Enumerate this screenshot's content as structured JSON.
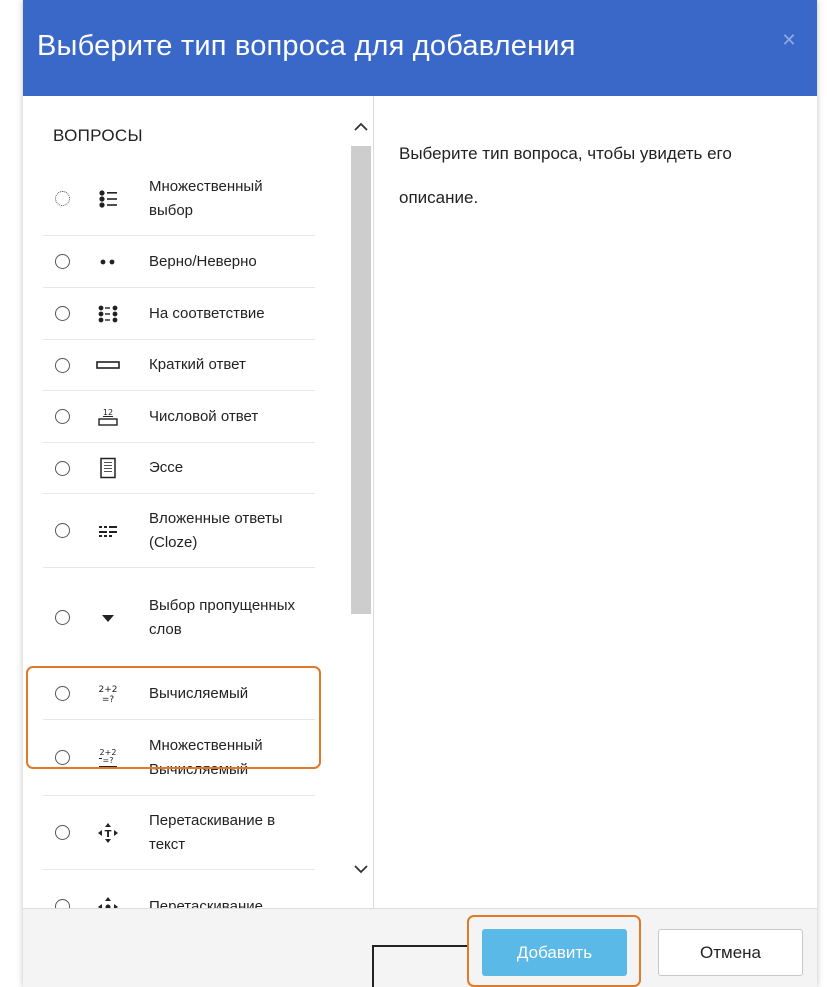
{
  "dialog": {
    "title": "Выберите тип вопроса для добавления",
    "close_icon": "close-icon"
  },
  "left": {
    "heading": "ВОПРОСЫ",
    "items": [
      {
        "label": "Множественный выбор",
        "icon": "multichoice-icon",
        "lines": 2,
        "dotted": true
      },
      {
        "label": "Верно/Неверно",
        "icon": "truefalse-icon",
        "lines": 1
      },
      {
        "label": "На соответствие",
        "icon": "match-icon",
        "lines": 1
      },
      {
        "label": "Краткий ответ",
        "icon": "shortanswer-icon",
        "lines": 1
      },
      {
        "label": "Числовой ответ",
        "icon": "numerical-icon",
        "lines": 1
      },
      {
        "label": "Эссе",
        "icon": "essay-icon",
        "lines": 1
      },
      {
        "label": "Вложенные ответы (Cloze)",
        "icon": "cloze-icon",
        "lines": 2
      },
      {
        "label": "Выбор пропущенных слов",
        "icon": "gapselect-icon",
        "lines": 3,
        "highlighted": true
      },
      {
        "label": "Вычисляемый",
        "icon": "calculated-icon",
        "lines": 1
      },
      {
        "label": "Множественный Вычисляемый",
        "icon": "calculatedmulti-icon",
        "lines": 2
      },
      {
        "label": "Перетаскивание в текст",
        "icon": "ddwtos-icon",
        "lines": 2
      },
      {
        "label": "Перетаскивание",
        "icon": "ddimage-icon",
        "lines": 2
      }
    ]
  },
  "right": {
    "description": "Выберите тип вопроса, чтобы увидеть его описание."
  },
  "footer": {
    "add_label": "Добавить",
    "cancel_label": "Отмена"
  },
  "colors": {
    "header": "#3a68c8",
    "add_button": "#5ab9e6",
    "highlight": "#e07a2a"
  }
}
